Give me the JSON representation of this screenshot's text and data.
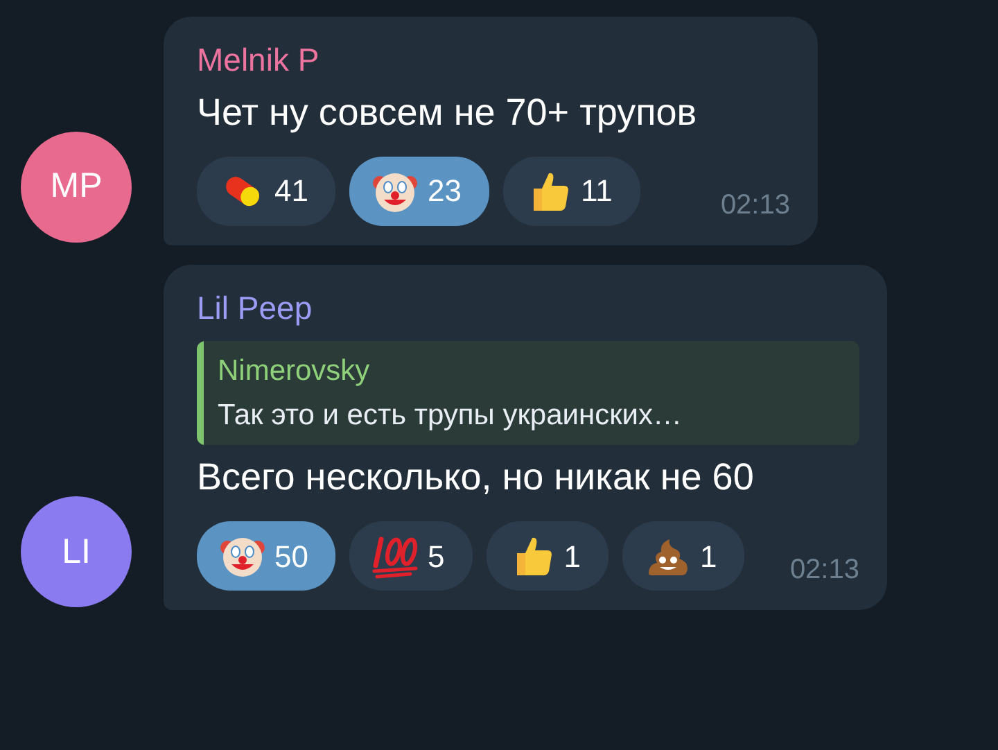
{
  "messages": [
    {
      "avatar": {
        "initials": "MP",
        "color": "#e86a8e"
      },
      "author": {
        "name": "Melnik P",
        "color": "#ee74a0"
      },
      "text": "Чет ну совсем не 70+ трупов",
      "reactions": [
        {
          "kind": "pill",
          "count": "41",
          "selected": false
        },
        {
          "kind": "clown",
          "count": "23",
          "selected": true
        },
        {
          "kind": "thumbs",
          "count": "11",
          "selected": false
        }
      ],
      "time": "02:13"
    },
    {
      "avatar": {
        "initials": "LI",
        "color": "#8a7cf0"
      },
      "author": {
        "name": "Lil Peep",
        "color": "#9c9cf5"
      },
      "reply": {
        "author": "Nimerovsky",
        "text": "Так это и есть трупы украинских…"
      },
      "text": "Всего несколько, но никак не 60",
      "reactions": [
        {
          "kind": "clown",
          "count": "50",
          "selected": true
        },
        {
          "kind": "hundred",
          "count": "5",
          "selected": false
        },
        {
          "kind": "thumbs",
          "count": "1",
          "selected": false
        },
        {
          "kind": "poop",
          "count": "1",
          "selected": false
        }
      ],
      "time": "02:13"
    }
  ]
}
